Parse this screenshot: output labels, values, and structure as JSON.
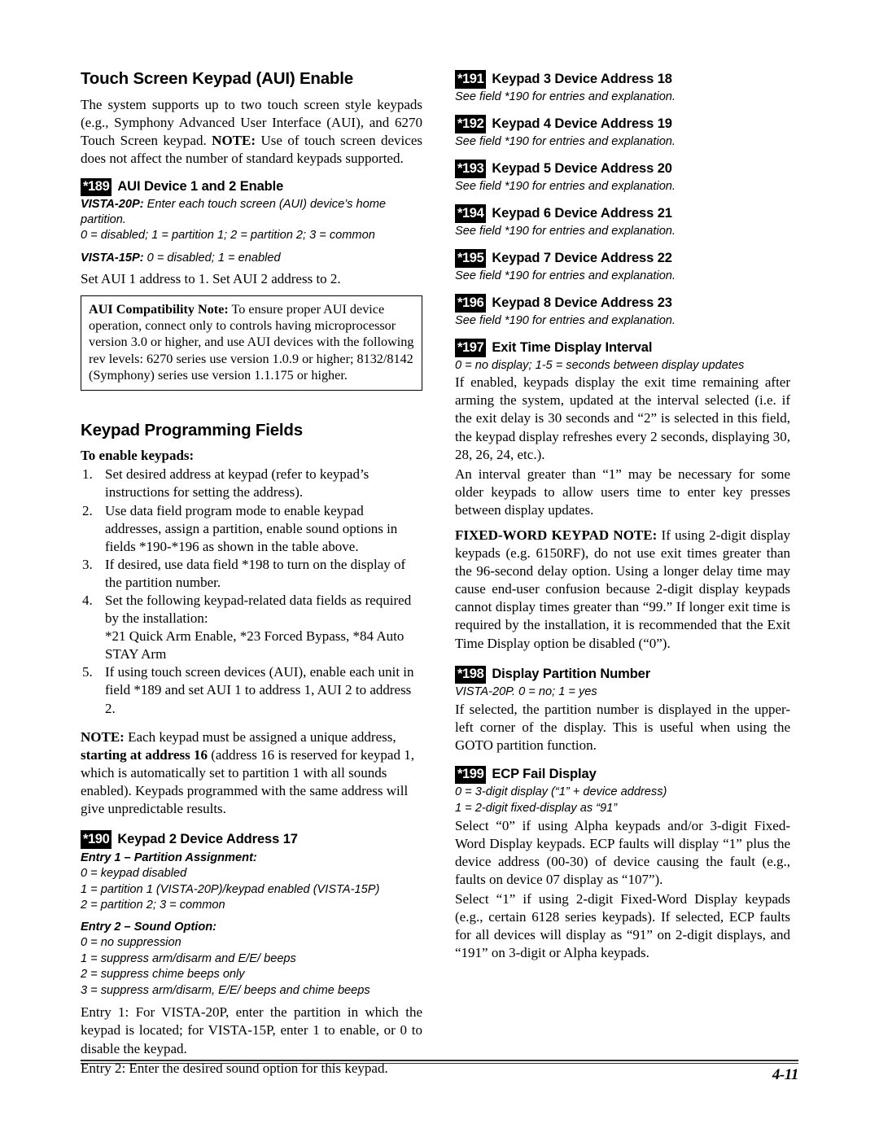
{
  "document": {
    "page_number": "4-11"
  },
  "left_column": {
    "heading_1": "Touch Screen Keypad (AUI) Enable",
    "intro_paragraph_part1": "The system supports up to two touch screen style keypads (e.g., Symphony Advanced User Interface (AUI), and 6270 Touch Screen keypad. ",
    "intro_paragraph_note_label": "NOTE:",
    "intro_paragraph_part2": " Use of touch screen devices does not affect the number of standard keypads supported.",
    "field_189": {
      "badge": "*189",
      "title": "AUI Device 1 and 2 Enable",
      "line1_label": "VISTA-20P:",
      "line1_text": " Enter each touch screen (AUI) device’s home partition.",
      "line2": "0 = disabled; 1 = partition 1; 2 = partition 2; 3 = common",
      "line3_label": "VISTA-15P:",
      "line3_text": " 0 = disabled; 1 = enabled",
      "line4": "Set AUI 1 address to 1. Set AUI 2 address to 2."
    },
    "aui_note_box": {
      "label": "AUI Compatibility Note:",
      "text": " To ensure proper AUI device operation, connect only to controls having microprocessor version 3.0 or higher, and use AUI devices with the following rev levels: 6270 series use version 1.0.9 or higher; 8132/8142 (Symphony) series use version 1.1.175 or higher."
    },
    "heading_2": "Keypad Programming Fields",
    "enable_keypads_label": "To enable keypads:",
    "steps": [
      "Set desired address at keypad (refer to keypad’s instructions for setting the address).",
      "Use data field program mode to enable keypad addresses, assign a partition, enable sound options in fields *190-*196 as shown in the table above.",
      "If desired, use data field *198 to turn on the display of the partition number.",
      "Set the following keypad-related data fields as required by the installation:",
      "If using touch screen devices (AUI), enable each unit in field *189 and set AUI 1 to address 1, AUI 2 to address 2."
    ],
    "step4_sub": "*21  Quick Arm Enable, *23  Forced Bypass, *84 Auto STAY Arm",
    "unique_address_note": {
      "label": "NOTE:",
      "part1": " Each keypad must be assigned a unique address, ",
      "bold_phrase": "starting at address 16",
      "part2": " (address 16 is reserved for keypad 1, which is automatically set to partition 1 with all sounds enabled). Keypads programmed with the same address will give unpredictable results."
    },
    "field_190": {
      "badge": "*190",
      "title": "Keypad 2 Device Address 17",
      "entry1_label": "Entry 1 – Partition Assignment:",
      "entry1_options": [
        "0 = keypad disabled",
        "1 = partition 1 (VISTA-20P)/keypad enabled (VISTA-15P)",
        "2 = partition 2; 3 = common"
      ],
      "entry2_label": "Entry 2 – Sound Option:",
      "entry2_options": [
        "0 = no suppression",
        "1 = suppress arm/disarm and E/E/ beeps",
        "2 = suppress chime beeps only",
        "3 = suppress arm/disarm, E/E/ beeps and chime beeps"
      ],
      "entry1_explanation": "Entry 1: For VISTA-20P, enter the partition in which the keypad is located; for VISTA-15P, enter 1 to enable, or 0 to disable the keypad.",
      "entry2_explanation": "Entry 2: Enter the desired sound option for this keypad."
    }
  },
  "right_column": {
    "field_191": {
      "badge": "*191",
      "title": "Keypad 3 Device Address 18",
      "note": "See field *190 for entries and explanation."
    },
    "field_192": {
      "badge": "*192",
      "title": "Keypad 4 Device Address 19",
      "note": "See field *190 for entries and explanation."
    },
    "field_193": {
      "badge": "*193",
      "title": "Keypad 5 Device Address 20",
      "note": "See field *190 for entries and explanation."
    },
    "field_194": {
      "badge": "*194",
      "title": "Keypad 6 Device Address 21",
      "note": "See field *190 for entries and explanation."
    },
    "field_195": {
      "badge": "*195",
      "title": "Keypad 7 Device Address 22",
      "note": "See field *190 for entries and explanation."
    },
    "field_196": {
      "badge": "*196",
      "title": "Keypad 8 Device Address 23",
      "note": "See field *190 for entries and explanation."
    },
    "field_197": {
      "badge": "*197",
      "title": "Exit Time Display Interval",
      "options": "0 = no display; 1-5 = seconds between display updates",
      "para1": "If enabled, keypads display the exit time remaining after arming the system, updated at the interval selected (i.e. if the exit delay is 30 seconds and “2” is selected in this field, the keypad display refreshes every 2 seconds, displaying 30, 28, 26, 24, etc.).",
      "para2": "An interval greater than “1” may be necessary for some older keypads to allow users time to enter key presses between display updates.",
      "fixed_word_label": "FIXED-WORD KEYPAD NOTE:",
      "fixed_word_text": " If using 2-digit display keypads (e.g. 6150RF), do not use exit times greater than the 96-second delay option. Using a longer delay time may cause end-user confusion because 2-digit display keypads cannot display times greater than “99.” If longer exit time is required by the installation, it is recommended that the Exit Time Display option be disabled (“0”)."
    },
    "field_198": {
      "badge": "*198",
      "title": "Display Partition Number",
      "options": "VISTA-20P.  0 = no; 1 = yes",
      "para": "If selected, the partition number is displayed in the upper-left corner of the display. This is useful when using the GOTO partition function."
    },
    "field_199": {
      "badge": "*199",
      "title": "ECP Fail Display",
      "option1": "0 = 3-digit display (“1” + device address)",
      "option2": "1 = 2-digit fixed-display as “91”",
      "para1": "Select “0” if using Alpha keypads and/or 3-digit Fixed-Word Display keypads. ECP faults will display “1” plus the device address (00-30) of device causing the fault (e.g., faults on device 07 display as “107”).",
      "para2": "Select “1” if using 2-digit Fixed-Word Display keypads (e.g., certain 6128 series keypads). If selected, ECP faults for all devices will display as “91” on 2-digit displays, and “191” on 3-digit or Alpha keypads."
    }
  }
}
